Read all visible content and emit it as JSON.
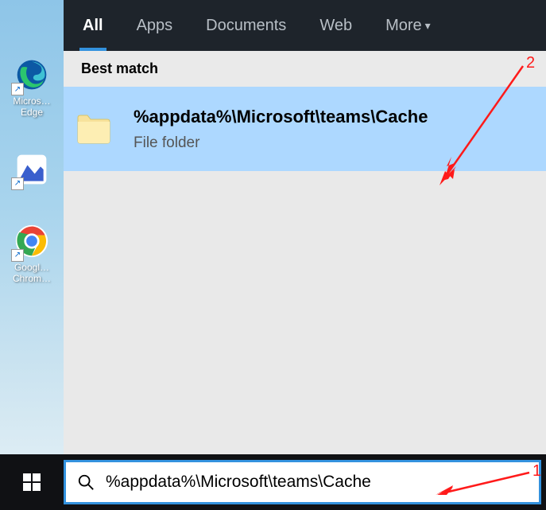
{
  "desktop": {
    "icons": [
      {
        "name": "edge",
        "label": "Micros…\nEdge"
      },
      {
        "name": "mgeneric",
        "label": ""
      },
      {
        "name": "chrome",
        "label": "Googl…\nChrom…"
      }
    ]
  },
  "tabs": [
    {
      "id": "all",
      "label": "All",
      "active": true
    },
    {
      "id": "apps",
      "label": "Apps",
      "active": false
    },
    {
      "id": "documents",
      "label": "Documents",
      "active": false
    },
    {
      "id": "web",
      "label": "Web",
      "active": false
    },
    {
      "id": "more",
      "label": "More",
      "active": false,
      "hasChevron": true
    }
  ],
  "section_header": "Best match",
  "result": {
    "title": "%appdata%\\Microsoft\\teams\\Cache",
    "subtitle": "File folder"
  },
  "search": {
    "value": "%appdata%\\Microsoft\\teams\\Cache"
  },
  "annotations": {
    "num1": "1",
    "num2": "2"
  }
}
